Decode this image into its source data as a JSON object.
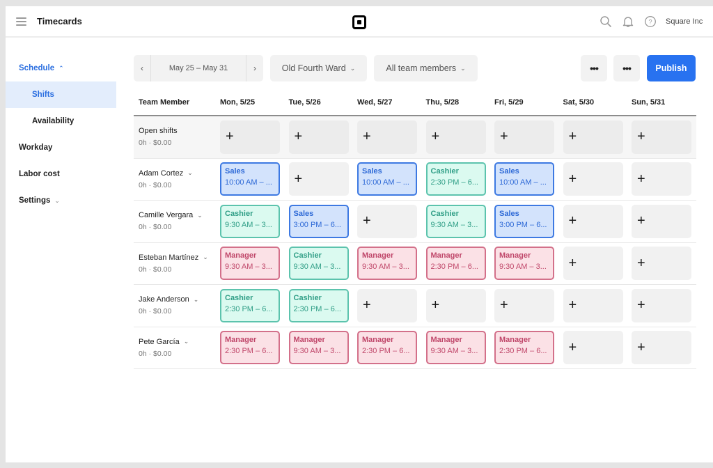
{
  "header": {
    "title": "Timecards",
    "account": "Square Inc",
    "icons": [
      "menu-icon",
      "square-logo",
      "search-icon",
      "bell-icon",
      "help-icon"
    ]
  },
  "sidebar": {
    "items": [
      {
        "label": "Schedule",
        "chevron": "^",
        "state": "expanded"
      },
      {
        "label": "Shifts",
        "state": "selected"
      },
      {
        "label": "Availability"
      },
      {
        "label": "Workday"
      },
      {
        "label": "Labor cost"
      },
      {
        "label": "Settings",
        "chevron": "v"
      }
    ]
  },
  "toolbar": {
    "prev": "‹",
    "next": "›",
    "date_range": "May 25 – May 31",
    "location": "Old Fourth Ward",
    "members_filter": "All team members",
    "chevron": "⌄",
    "more_1": "•••",
    "more_2": "•••",
    "publish": "Publish"
  },
  "schedule": {
    "columns": [
      "Team Member",
      "Mon, 5/25",
      "Tue, 5/26",
      "Wed, 5/27",
      "Thu, 5/28",
      "Fri, 5/29",
      "Sat, 5/30",
      "Sun, 5/31"
    ],
    "add_symbol": "+",
    "rows": [
      {
        "name": "Open shifts",
        "summary": "0h · $0.00",
        "dropdown": false,
        "shifts": [
          null,
          null,
          null,
          null,
          null,
          null,
          null
        ]
      },
      {
        "name": "Adam Cortez",
        "summary": "0h · $0.00",
        "dropdown": true,
        "shifts": [
          {
            "role": "Sales",
            "time": "10:00 AM – ...",
            "type": "sales"
          },
          null,
          {
            "role": "Sales",
            "time": "10:00 AM – ...",
            "type": "sales"
          },
          {
            "role": "Cashier",
            "time": "2:30 PM – 6...",
            "type": "cashier"
          },
          {
            "role": "Sales",
            "time": "10:00 AM – ...",
            "type": "sales"
          },
          null,
          null
        ]
      },
      {
        "name": "Camille Vergara",
        "summary": "0h · $0.00",
        "dropdown": true,
        "shifts": [
          {
            "role": "Cashier",
            "time": "9:30 AM – 3...",
            "type": "cashier"
          },
          {
            "role": "Sales",
            "time": "3:00 PM – 6...",
            "type": "sales"
          },
          null,
          {
            "role": "Cashier",
            "time": "9:30 AM – 3...",
            "type": "cashier"
          },
          {
            "role": "Sales",
            "time": "3:00 PM – 6...",
            "type": "sales"
          },
          null,
          null
        ]
      },
      {
        "name": "Esteban Martínez",
        "summary": "0h · $0.00",
        "dropdown": true,
        "shifts": [
          {
            "role": "Manager",
            "time": "9:30 AM – 3...",
            "type": "manager"
          },
          {
            "role": "Cashier",
            "time": "9:30 AM – 3...",
            "type": "cashier"
          },
          {
            "role": "Manager",
            "time": "9:30 AM – 3...",
            "type": "manager"
          },
          {
            "role": "Manager",
            "time": "2:30 PM – 6...",
            "type": "manager"
          },
          {
            "role": "Manager",
            "time": "9:30 AM – 3...",
            "type": "manager"
          },
          null,
          null
        ]
      },
      {
        "name": "Jake Anderson",
        "summary": "0h · $0.00",
        "dropdown": true,
        "shifts": [
          {
            "role": "Cashier",
            "time": "2:30 PM – 6...",
            "type": "cashier"
          },
          {
            "role": "Cashier",
            "time": "2:30 PM – 6...",
            "type": "cashier"
          },
          null,
          null,
          null,
          null,
          null
        ]
      },
      {
        "name": "Pete García",
        "summary": "0h · $0.00",
        "dropdown": true,
        "shifts": [
          {
            "role": "Manager",
            "time": "2:30 PM – 6...",
            "type": "manager"
          },
          {
            "role": "Manager",
            "time": "9:30 AM – 3...",
            "type": "manager"
          },
          {
            "role": "Manager",
            "time": "2:30 PM – 6...",
            "type": "manager"
          },
          {
            "role": "Manager",
            "time": "9:30 AM – 3...",
            "type": "manager"
          },
          {
            "role": "Manager",
            "time": "2:30 PM – 6...",
            "type": "manager"
          },
          null,
          null
        ]
      }
    ]
  },
  "colors": {
    "accent": "#2872f0",
    "sales": "#3d79e2",
    "cashier": "#5cc3ad",
    "manager": "#d3708a"
  }
}
